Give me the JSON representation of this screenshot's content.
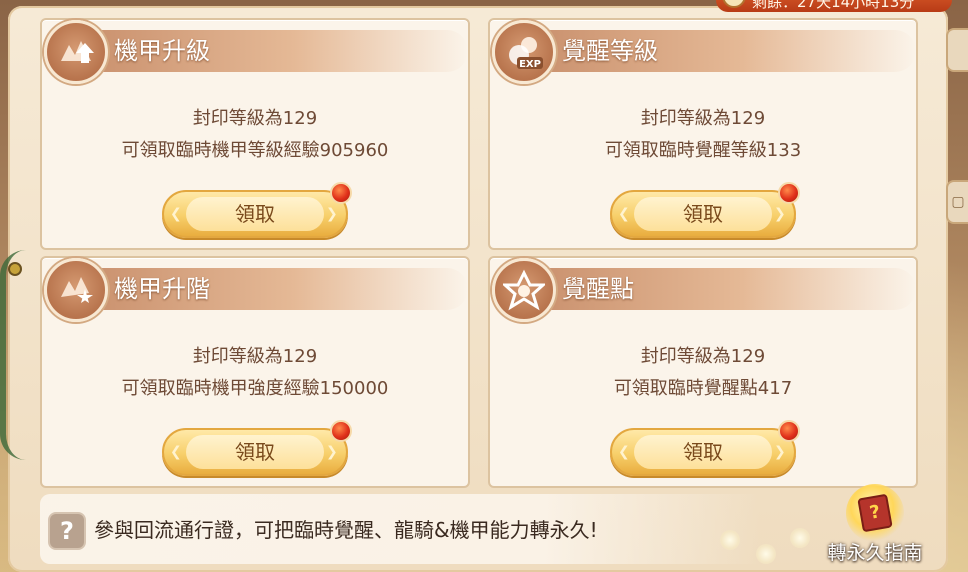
{
  "timer": {
    "text": "剩餘：27天14小時13分"
  },
  "cards": [
    {
      "id": "mech-upgrade",
      "title": "機甲升級",
      "icon": "mech-upgrade-arrow-icon",
      "line1": "封印等級為129",
      "line2": "可領取臨時機甲等級經驗905960",
      "button": "領取"
    },
    {
      "id": "awakening-level",
      "title": "覺醒等級",
      "icon": "awakening-exp-icon",
      "line1": "封印等級為129",
      "line2": "可領取臨時覺醒等級133",
      "button": "領取"
    },
    {
      "id": "mech-advance",
      "title": "機甲升階",
      "icon": "mech-advance-star-icon",
      "line1": "封印等級為129",
      "line2": "可領取臨時機甲強度經驗150000",
      "button": "領取"
    },
    {
      "id": "awakening-points",
      "title": "覺醒點",
      "icon": "awakening-points-star-icon",
      "line1": "封印等級為129",
      "line2": "可領取臨時覺醒點417",
      "button": "領取"
    }
  ],
  "notice": {
    "text": "參與回流通行證，可把臨時覺醒、龍騎&機甲能力轉永久!"
  },
  "guide": {
    "label": "轉永久指南",
    "icon": "guide-book-icon"
  },
  "colors": {
    "accent_red": "#e0301a",
    "button_gold": "#f7cf6a",
    "header_brown": "#c9906d"
  }
}
